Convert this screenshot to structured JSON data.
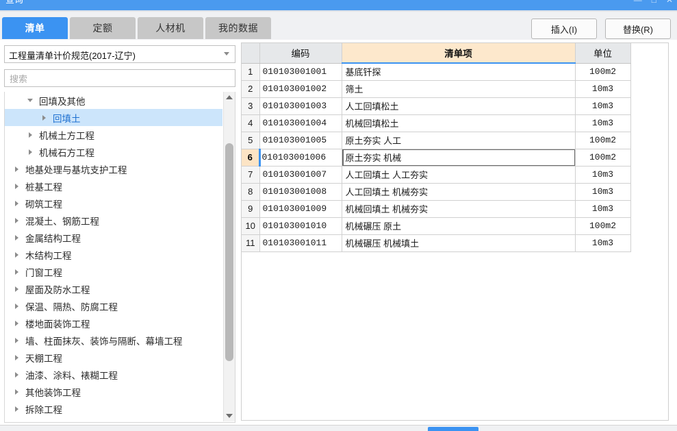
{
  "window": {
    "title": "查询",
    "controls": [
      {
        "name": "minimize",
        "glyph": "—"
      },
      {
        "name": "maximize",
        "glyph": "□"
      },
      {
        "name": "close",
        "glyph": "✕"
      }
    ],
    "accent_color": "#4a9aef"
  },
  "tabs": [
    {
      "label": "清单",
      "active": true
    },
    {
      "label": "定额",
      "active": false
    },
    {
      "label": "人材机",
      "active": false
    },
    {
      "label": "我的数据",
      "active": false
    }
  ],
  "toolbar": {
    "insert_label": "插入(I)",
    "replace_label": "替换(R)"
  },
  "left_panel": {
    "standard_select": {
      "value": "工程量清单计价规范(2017-辽宁)"
    },
    "search": {
      "value": "",
      "placeholder": "搜索"
    },
    "tree": [
      {
        "label": "回填及其他",
        "indent": 2,
        "state": "expanded",
        "selected": false
      },
      {
        "label": "回填土",
        "indent": 3,
        "state": "collapsed",
        "selected": true
      },
      {
        "label": "机械土方工程",
        "indent": 2,
        "state": "collapsed",
        "selected": false
      },
      {
        "label": "机械石方工程",
        "indent": 2,
        "state": "collapsed",
        "selected": false
      },
      {
        "label": "地基处理与基坑支护工程",
        "indent": 1,
        "state": "collapsed",
        "selected": false
      },
      {
        "label": "桩基工程",
        "indent": 1,
        "state": "collapsed",
        "selected": false
      },
      {
        "label": "砌筑工程",
        "indent": 1,
        "state": "collapsed",
        "selected": false
      },
      {
        "label": "混凝土、钢筋工程",
        "indent": 1,
        "state": "collapsed",
        "selected": false
      },
      {
        "label": "金属结构工程",
        "indent": 1,
        "state": "collapsed",
        "selected": false
      },
      {
        "label": "木结构工程",
        "indent": 1,
        "state": "collapsed",
        "selected": false
      },
      {
        "label": "门窗工程",
        "indent": 1,
        "state": "collapsed",
        "selected": false
      },
      {
        "label": "屋面及防水工程",
        "indent": 1,
        "state": "collapsed",
        "selected": false
      },
      {
        "label": "保温、隔热、防腐工程",
        "indent": 1,
        "state": "collapsed",
        "selected": false
      },
      {
        "label": "楼地面装饰工程",
        "indent": 1,
        "state": "collapsed",
        "selected": false
      },
      {
        "label": "墙、柱面抹灰、装饰与隔断、幕墙工程",
        "indent": 1,
        "state": "collapsed",
        "selected": false
      },
      {
        "label": "天棚工程",
        "indent": 1,
        "state": "collapsed",
        "selected": false
      },
      {
        "label": "油漆、涂料、裱糊工程",
        "indent": 1,
        "state": "collapsed",
        "selected": false
      },
      {
        "label": "其他装饰工程",
        "indent": 1,
        "state": "collapsed",
        "selected": false
      },
      {
        "label": "拆除工程",
        "indent": 1,
        "state": "collapsed",
        "selected": false
      }
    ]
  },
  "grid": {
    "columns": [
      {
        "key": "idx",
        "label": "",
        "highlight": false
      },
      {
        "key": "code",
        "label": "编码",
        "highlight": false
      },
      {
        "key": "item",
        "label": "清单项",
        "highlight": true
      },
      {
        "key": "unit",
        "label": "单位",
        "highlight": false
      }
    ],
    "rows": [
      {
        "idx": "1",
        "code": "010103001001",
        "item": "基底钎探",
        "unit": "100m2",
        "selected": false
      },
      {
        "idx": "2",
        "code": "010103001002",
        "item": "筛土",
        "unit": "10m3",
        "selected": false
      },
      {
        "idx": "3",
        "code": "010103001003",
        "item": "人工回填松土",
        "unit": "10m3",
        "selected": false
      },
      {
        "idx": "4",
        "code": "010103001004",
        "item": "机械回填松土",
        "unit": "10m3",
        "selected": false
      },
      {
        "idx": "5",
        "code": "010103001005",
        "item": "原土夯实 人工",
        "unit": "100m2",
        "selected": false
      },
      {
        "idx": "6",
        "code": "010103001006",
        "item": "原土夯实 机械",
        "unit": "100m2",
        "selected": true
      },
      {
        "idx": "7",
        "code": "010103001007",
        "item": "人工回填土 人工夯实",
        "unit": "10m3",
        "selected": false
      },
      {
        "idx": "8",
        "code": "010103001008",
        "item": "人工回填土 机械夯实",
        "unit": "10m3",
        "selected": false
      },
      {
        "idx": "9",
        "code": "010103001009",
        "item": "机械回填土 机械夯实",
        "unit": "10m3",
        "selected": false
      },
      {
        "idx": "10",
        "code": "010103001010",
        "item": "机械碾压 原土",
        "unit": "100m2",
        "selected": false
      },
      {
        "idx": "11",
        "code": "010103001011",
        "item": "机械碾压 机械填土",
        "unit": "10m3",
        "selected": false
      }
    ]
  },
  "footer": {
    "confirm_button_color": "#3b93f2"
  }
}
